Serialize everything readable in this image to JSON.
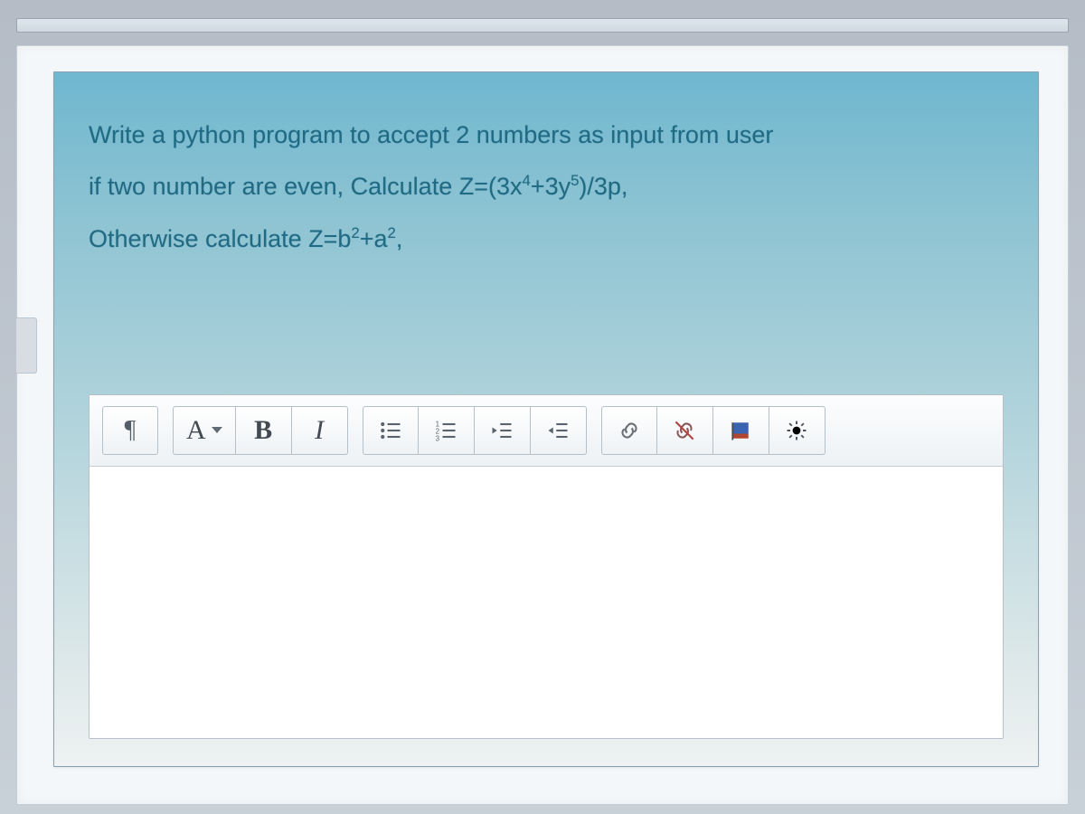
{
  "question": {
    "line1": "Write a python program to accept 2 numbers as input from user",
    "line2_prefix": "if two number are even, Calculate Z=(3x",
    "line2_exp1": "4",
    "line2_mid": "+3y",
    "line2_exp2": "5",
    "line2_suffix": ")/3p,",
    "line3_prefix": "Otherwise calculate Z=b",
    "line3_exp1": "2",
    "line3_mid": "+a",
    "line3_exp2": "2",
    "line3_suffix": ","
  },
  "toolbar": {
    "paragraph_label": "¶",
    "font_label": "A",
    "bold_label": "B",
    "italic_label": "I"
  },
  "icons": {
    "paragraph": "paragraph-icon",
    "font_color": "font-color-icon",
    "bold": "bold-icon",
    "italic": "italic-icon",
    "ul": "bulleted-list-icon",
    "ol": "numbered-list-icon",
    "outdent": "outdent-icon",
    "indent": "indent-icon",
    "link": "link-icon",
    "unlink": "unlink-icon",
    "flag": "language-flag-icon",
    "settings": "settings-icon"
  }
}
